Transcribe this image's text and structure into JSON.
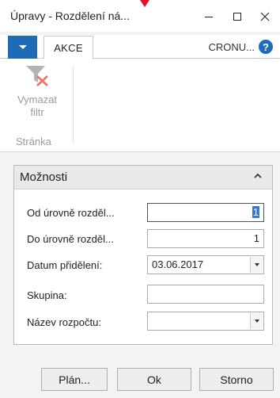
{
  "window": {
    "title": "Úpravy - Rozdělení ná...",
    "controls": {
      "minimize": "minimize-icon",
      "maximize": "maximize-icon",
      "close": "close-icon"
    }
  },
  "ribbon": {
    "tabs": [
      {
        "label": "AKCE"
      }
    ],
    "company": "CRONU...",
    "help_icon_text": "?",
    "actions": [
      {
        "label_line1": "Vymazat",
        "label_line2": "filtr",
        "icon": "clear-filter-icon",
        "enabled": false
      }
    ],
    "group_label": "Stránka"
  },
  "panel": {
    "title": "Možnosti",
    "fields": [
      {
        "label": "Od úrovně rozděl...",
        "value": "1",
        "selected": true
      },
      {
        "label": "Do úrovně rozděl...",
        "value": "1"
      },
      {
        "label": "Datum přidělení:",
        "value": "03.06.2017",
        "dropdown": true
      },
      {
        "label": "Skupina:",
        "value": ""
      },
      {
        "label": "Název rozpočtu:",
        "value": "",
        "dropdown": true
      }
    ]
  },
  "buttons": {
    "plan": "Plán...",
    "ok": "Ok",
    "cancel": "Storno"
  },
  "colors": {
    "accent": "#1e6bb8",
    "clear_filter_x": "#e8756b"
  }
}
